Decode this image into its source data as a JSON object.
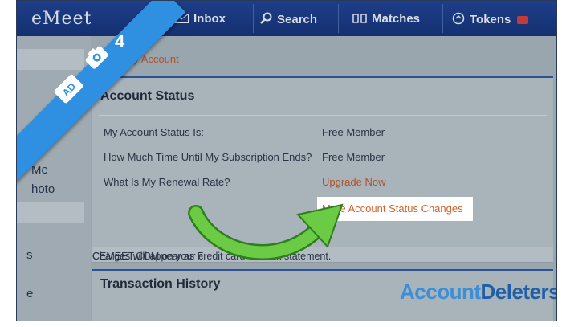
{
  "brand": "eMeet",
  "nav": {
    "inbox": "Inbox",
    "search": "Search",
    "matches": "Matches",
    "tokens": "Tokens"
  },
  "sidebar": {
    "item_me": "Me",
    "item_photo": "hoto",
    "item_s": "s",
    "item_e": "e"
  },
  "back_link": "k to My Account",
  "account_status": {
    "title": "Account Status",
    "rows": [
      {
        "label": "My Account Status Is:",
        "value": "Free Member"
      },
      {
        "label": "How Much Time Until My Subscription Ends?",
        "value": "Free Member"
      },
      {
        "label": "What Is My Renewal Rate?",
        "value": "Upgrade Now"
      }
    ],
    "more_link": "More Account Status Changes"
  },
  "notice": "Charges will appear as F",
  "notice_tail": "CEMEET.COM on your credit card or bank statement.",
  "transaction_history": {
    "title": "Transaction History"
  },
  "step_badge": "4",
  "watermark": {
    "part1": "Account",
    "part2": "Deleters"
  },
  "colors": {
    "header": "#14306f",
    "link": "#b0512c",
    "highlight_link": "#d0622a",
    "ribbon": "#2f8fe0",
    "arrow": "#5cbf3a"
  }
}
